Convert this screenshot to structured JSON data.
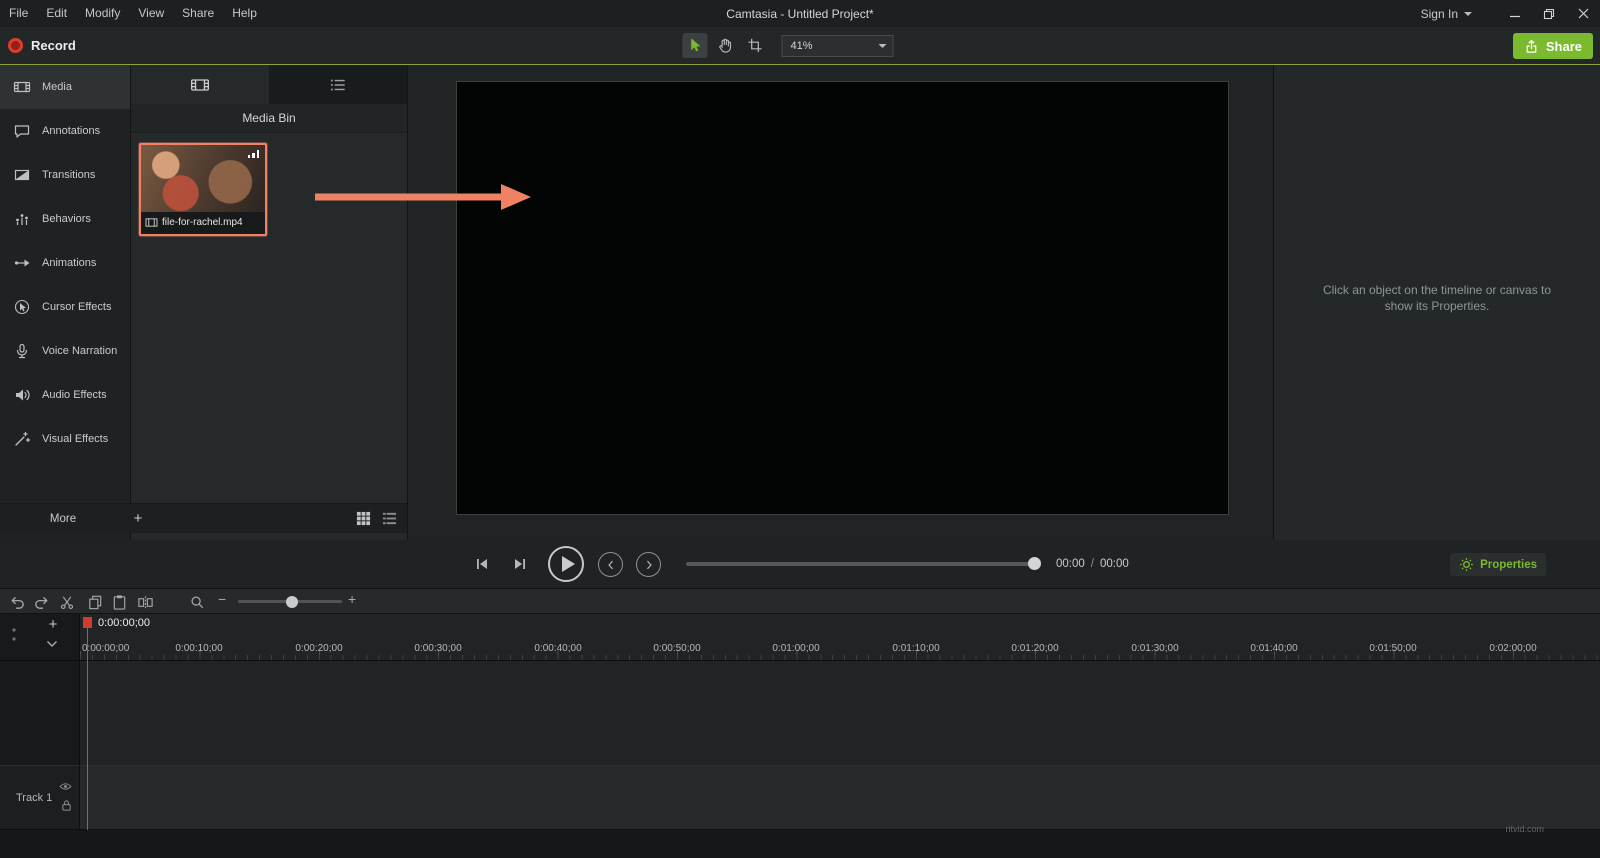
{
  "titlebar": {
    "menus": [
      "File",
      "Edit",
      "Modify",
      "View",
      "Share",
      "Help"
    ],
    "title": "Camtasia - Untitled Project*",
    "sign_in_label": "Sign In"
  },
  "toolbar": {
    "record_label": "Record",
    "zoom_value": "41%",
    "share_label": "Share"
  },
  "sidebar": {
    "items": [
      {
        "label": "Media"
      },
      {
        "label": "Annotations"
      },
      {
        "label": "Transitions"
      },
      {
        "label": "Behaviors"
      },
      {
        "label": "Animations"
      },
      {
        "label": "Cursor Effects"
      },
      {
        "label": "Voice Narration"
      },
      {
        "label": "Audio Effects"
      },
      {
        "label": "Visual Effects"
      }
    ],
    "more_label": "More",
    "add_label": "+"
  },
  "media_bin": {
    "title": "Media Bin",
    "items": [
      {
        "filename": "file-for-rachel.mp4"
      }
    ]
  },
  "properties": {
    "hint": "Click an object on the timeline or canvas to show its Properties.",
    "button_label": "Properties"
  },
  "playback": {
    "current_time": "00:00",
    "separator": "/",
    "total_time": "00:00"
  },
  "timeline_toolbar": {
    "zoom_out_label": "−",
    "zoom_in_label": "+"
  },
  "timeline": {
    "playhead_time": "0:00:00;00",
    "add_track_label": "+",
    "ruler_ticks": [
      "0:00:00;00",
      "0:00:10;00",
      "0:00:20;00",
      "0:00:30;00",
      "0:00:40;00",
      "0:00:50;00",
      "0:01:00;00",
      "0:01:10;00",
      "0:01:20;00",
      "0:01:30;00",
      "0:01:40;00",
      "0:01:50;00",
      "0:02:00;00"
    ],
    "tracks": [
      {
        "name": "Track 1"
      }
    ]
  },
  "watermark": "ritvid.com",
  "colors": {
    "accent_green": "#7bb92f",
    "accent_orange": "#ee8263",
    "record_red": "#e23c30"
  }
}
